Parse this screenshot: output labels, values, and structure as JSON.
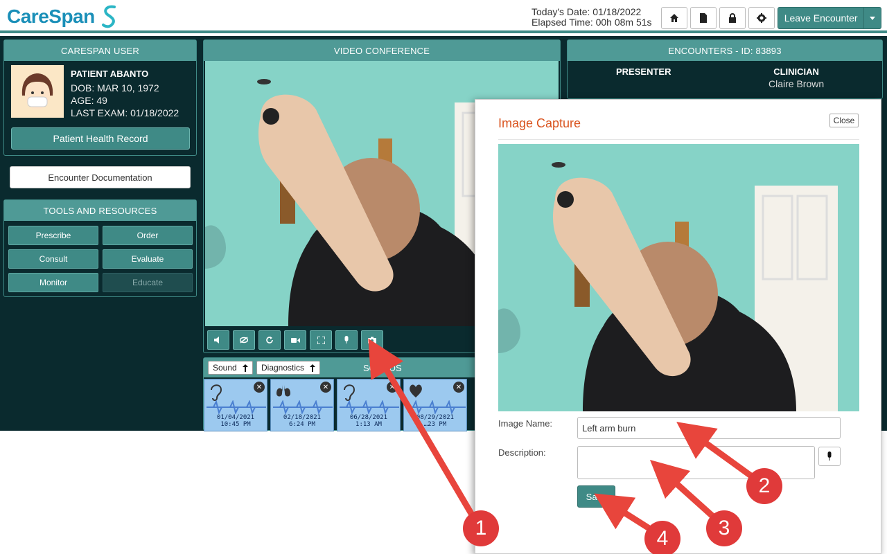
{
  "header": {
    "logo_text": "CareSpan",
    "todays_date": "Today's Date: 01/18/2022",
    "elapsed_time": "Elapsed Time: 00h 08m 51s",
    "leave_label": "Leave Encounter"
  },
  "user_panel": {
    "title": "CARESPAN USER",
    "patient_name": "PATIENT ABANTO",
    "dob": "DOB: MAR 10, 1972",
    "age": "AGE: 49",
    "last_exam": "LAST EXAM: 01/18/2022",
    "phr_label": "Patient Health Record"
  },
  "encounter_doc_label": "Encounter Documentation",
  "tools": {
    "title": "TOOLS AND RESOURCES",
    "items": [
      {
        "label": "Prescribe",
        "enabled": true
      },
      {
        "label": "Order",
        "enabled": true
      },
      {
        "label": "Consult",
        "enabled": true
      },
      {
        "label": "Evaluate",
        "enabled": true
      },
      {
        "label": "Monitor",
        "enabled": true
      },
      {
        "label": "Educate",
        "enabled": false
      }
    ]
  },
  "video": {
    "title": "VIDEO CONFERENCE",
    "controls": [
      "volume-icon",
      "hide-video-icon",
      "refresh-icon",
      "camera-video-icon",
      "fullscreen-icon",
      "microphone-icon",
      "photo-camera-icon"
    ]
  },
  "sounds": {
    "title": "SOUNDS",
    "filter_sound": "Sound",
    "filter_diagnostics": "Diagnostics",
    "cards": [
      {
        "icon": "ear-icon",
        "date": "01/04/2021",
        "time": "10:45 PM"
      },
      {
        "icon": "lungs-icon",
        "date": "02/18/2021",
        "time": "6:24 PM"
      },
      {
        "icon": "ear-icon",
        "date": "06/28/2021",
        "time": "1:13 AM"
      },
      {
        "icon": "heart-icon",
        "date": "08/29/2021",
        "time": "…23 PM"
      }
    ]
  },
  "encounters": {
    "title": "ENCOUNTERS - ID: 83893",
    "presenter_label": "PRESENTER",
    "clinician_label": "CLINICIAN",
    "clinician_name": "Claire Brown"
  },
  "modal": {
    "title": "Image Capture",
    "close_label": "Close",
    "image_name_label": "Image Name:",
    "image_name_value": "Left arm burn",
    "description_label": "Description:",
    "description_value": "",
    "save_label": "Save"
  },
  "annotations": [
    "1",
    "2",
    "3",
    "4"
  ],
  "colors": {
    "accent": "#3f8a86",
    "panel_header": "#4f9a96",
    "dark_bg": "#0a2a2e",
    "modal_title": "#d9531e",
    "annotation": "#e03a3a"
  }
}
